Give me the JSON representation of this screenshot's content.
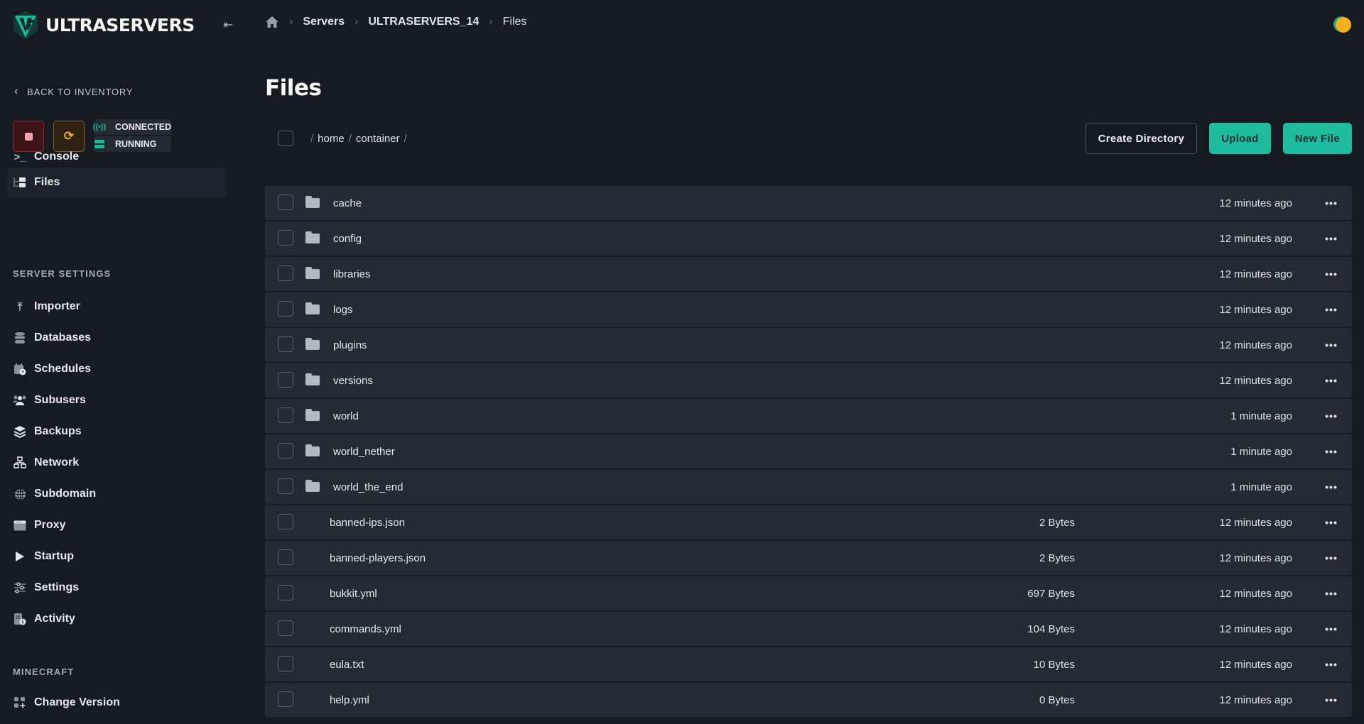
{
  "brand": {
    "name": "ULTRASERVERS",
    "accent": "#1ebc9e"
  },
  "breadcrumb": [
    {
      "label": "Servers"
    },
    {
      "label": "ULTRASERVERS_14"
    },
    {
      "label": "Files"
    }
  ],
  "sidebar": {
    "back_label": "BACK TO INVENTORY",
    "status": {
      "connection": "CONNECTED",
      "state": "RUNNING"
    },
    "primary": [
      {
        "label": "Console",
        "icon": "terminal-icon"
      },
      {
        "label": "Files",
        "icon": "files-icon",
        "active": true
      }
    ],
    "server_settings_title": "SERVER SETTINGS",
    "server_settings": [
      {
        "label": "Importer",
        "icon": "import-icon"
      },
      {
        "label": "Databases",
        "icon": "database-icon"
      },
      {
        "label": "Schedules",
        "icon": "calendar-clock-icon"
      },
      {
        "label": "Subusers",
        "icon": "users-icon"
      },
      {
        "label": "Backups",
        "icon": "layers-icon"
      },
      {
        "label": "Network",
        "icon": "network-icon"
      },
      {
        "label": "Subdomain",
        "icon": "globe-icon"
      },
      {
        "label": "Proxy",
        "icon": "window-icon"
      },
      {
        "label": "Startup",
        "icon": "play-icon"
      },
      {
        "label": "Settings",
        "icon": "sliders-icon"
      },
      {
        "label": "Activity",
        "icon": "activity-log-icon"
      }
    ],
    "minecraft_title": "MINECRAFT",
    "minecraft": [
      {
        "label": "Change Version",
        "icon": "grid-plus-icon"
      }
    ]
  },
  "main": {
    "title": "Files",
    "path": [
      "home",
      "container"
    ],
    "buttons": {
      "create_directory": "Create Directory",
      "upload": "Upload",
      "new_file": "New File"
    },
    "files": [
      {
        "name": "cache",
        "type": "folder",
        "size": "",
        "modified": "12 minutes ago"
      },
      {
        "name": "config",
        "type": "folder",
        "size": "",
        "modified": "12 minutes ago"
      },
      {
        "name": "libraries",
        "type": "folder",
        "size": "",
        "modified": "12 minutes ago"
      },
      {
        "name": "logs",
        "type": "folder",
        "size": "",
        "modified": "12 minutes ago"
      },
      {
        "name": "plugins",
        "type": "folder",
        "size": "",
        "modified": "12 minutes ago"
      },
      {
        "name": "versions",
        "type": "folder",
        "size": "",
        "modified": "12 minutes ago"
      },
      {
        "name": "world",
        "type": "folder",
        "size": "",
        "modified": "1 minute ago"
      },
      {
        "name": "world_nether",
        "type": "folder",
        "size": "",
        "modified": "1 minute ago"
      },
      {
        "name": "world_the_end",
        "type": "folder",
        "size": "",
        "modified": "1 minute ago"
      },
      {
        "name": "banned-ips.json",
        "type": "file",
        "size": "2 Bytes",
        "modified": "12 minutes ago"
      },
      {
        "name": "banned-players.json",
        "type": "file",
        "size": "2 Bytes",
        "modified": "12 minutes ago"
      },
      {
        "name": "bukkit.yml",
        "type": "file",
        "size": "697 Bytes",
        "modified": "12 minutes ago"
      },
      {
        "name": "commands.yml",
        "type": "file",
        "size": "104 Bytes",
        "modified": "12 minutes ago"
      },
      {
        "name": "eula.txt",
        "type": "file",
        "size": "10 Bytes",
        "modified": "12 minutes ago"
      },
      {
        "name": "help.yml",
        "type": "file",
        "size": "0 Bytes",
        "modified": "12 minutes ago"
      }
    ]
  }
}
